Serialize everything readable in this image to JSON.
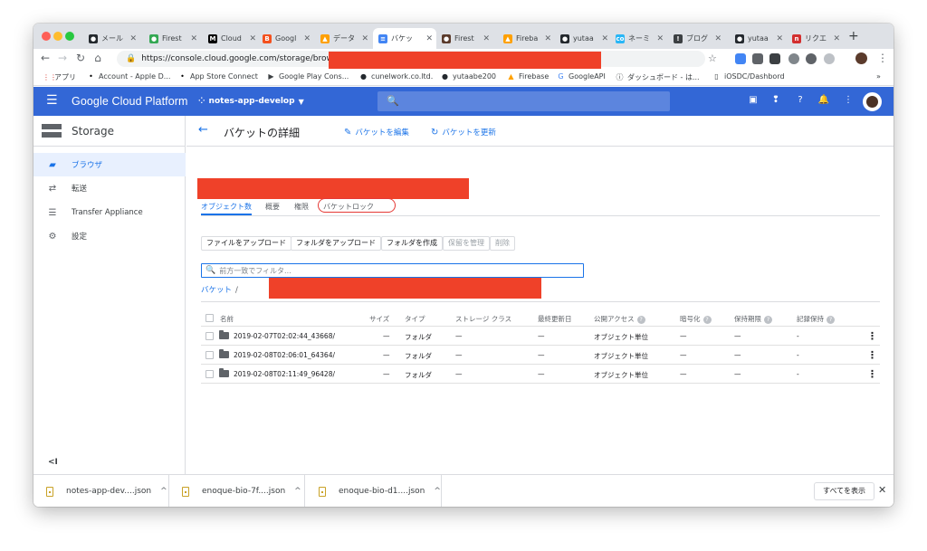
{
  "browser": {
    "tabs": [
      {
        "label": "メール",
        "fav_color": "#24292e",
        "fav_glyph": "●"
      },
      {
        "label": "Firest",
        "fav_color": "#34a853",
        "fav_glyph": "●"
      },
      {
        "label": "Cloud",
        "fav_color": "#000000",
        "fav_glyph": "M"
      },
      {
        "label": "Googl",
        "fav_color": "#f4511e",
        "fav_glyph": "B"
      },
      {
        "label": "データ",
        "fav_color": "#ffa000",
        "fav_glyph": "▲"
      },
      {
        "label": "バケッ",
        "fav_color": "#4285f4",
        "fav_glyph": "≡"
      },
      {
        "label": "Firest",
        "fav_color": "#5b3b2c",
        "fav_glyph": "●"
      },
      {
        "label": "Fireba",
        "fav_color": "#ffa000",
        "fav_glyph": "▲"
      },
      {
        "label": "yutaa",
        "fav_color": "#24292e",
        "fav_glyph": "●"
      },
      {
        "label": "ネーミ",
        "fav_color": "#29b6f6",
        "fav_glyph": "co"
      },
      {
        "label": "ブログ",
        "fav_color": "#3c4043",
        "fav_glyph": "!"
      },
      {
        "label": "yutaa",
        "fav_color": "#24292e",
        "fav_glyph": "●"
      },
      {
        "label": "リクエ",
        "fav_color": "#d32f2f",
        "fav_glyph": "n"
      }
    ],
    "active_tab_index": 5,
    "url": "https://console.cloud.google.com/storage/browse",
    "bookmarks": [
      {
        "label": "アプリ",
        "icon": "apps-grid-icon"
      },
      {
        "label": "Account - Apple D...",
        "icon": "apple-icon"
      },
      {
        "label": "App Store Connect",
        "icon": "apple-icon"
      },
      {
        "label": "Google Play Cons...",
        "icon": "play-icon"
      },
      {
        "label": "cunelwork.co.ltd.",
        "icon": "github-icon"
      },
      {
        "label": "yutaabe200",
        "icon": "github-icon"
      },
      {
        "label": "Firebase",
        "icon": "firebase-icon"
      },
      {
        "label": "GoogleAPI",
        "icon": "google-icon"
      },
      {
        "label": "ダッシュボード - は...",
        "icon": "info-icon"
      },
      {
        "label": "iOSDC/Dashbord",
        "icon": "page-icon"
      }
    ],
    "bookmarks_more": "»"
  },
  "header": {
    "title": "Google Cloud Platform",
    "project": "notes-app-develop"
  },
  "sidebar": {
    "title": "Storage",
    "items": [
      {
        "label": "ブラウザ",
        "icon": "bucket-icon",
        "active": true
      },
      {
        "label": "転送",
        "icon": "transfer-icon",
        "active": false
      },
      {
        "label": "Transfer Appliance",
        "icon": "list-icon",
        "active": false
      },
      {
        "label": "設定",
        "icon": "gear-icon",
        "active": false
      }
    ],
    "collapse_label": "<I"
  },
  "main": {
    "title": "バケットの詳細",
    "edit_label": "バケットを編集",
    "refresh_label": "バケットを更新",
    "tabs": [
      "オブジェクト数",
      "概要",
      "権限",
      "バケットロック"
    ],
    "buttons": [
      {
        "label": "ファイルをアップロード",
        "disabled": false
      },
      {
        "label": "フォルダをアップロード",
        "disabled": false
      },
      {
        "label": "フォルダを作成",
        "disabled": false
      },
      {
        "label": "保留を管理",
        "disabled": true
      },
      {
        "label": "削除",
        "disabled": true
      }
    ],
    "filter_placeholder": "前方一致でフィルタ...",
    "breadcrumb_root": "バケット",
    "breadcrumb_sep": "/",
    "columns": [
      "名前",
      "サイズ",
      "タイプ",
      "ストレージ クラス",
      "最終更新日",
      "公開アクセス",
      "暗号化",
      "保持期限",
      "記録保持"
    ],
    "rows": [
      {
        "name": "2019-02-07T02:02:44_43668/",
        "size": "—",
        "type": "フォルダ",
        "storage_class": "—",
        "updated": "—",
        "public_access": "オブジェクト単位",
        "encryption": "—",
        "retention": "—",
        "hold": "-"
      },
      {
        "name": "2019-02-08T02:06:01_64364/",
        "size": "—",
        "type": "フォルダ",
        "storage_class": "—",
        "updated": "—",
        "public_access": "オブジェクト単位",
        "encryption": "—",
        "retention": "—",
        "hold": "-"
      },
      {
        "name": "2019-02-08T02:11:49_96428/",
        "size": "—",
        "type": "フォルダ",
        "storage_class": "—",
        "updated": "—",
        "public_access": "オブジェクト単位",
        "encryption": "—",
        "retention": "—",
        "hold": "-"
      }
    ]
  },
  "downloads": {
    "items": [
      "notes-app-dev....json",
      "enoque-bio-7f....json",
      "enoque-bio-d1....json"
    ],
    "show_all": "すべてを表示"
  },
  "colors": {
    "header_blue": "#3367d6",
    "accent_blue": "#1a73e8",
    "redaction": "#ef4129",
    "annotation_red": "#e53935"
  }
}
